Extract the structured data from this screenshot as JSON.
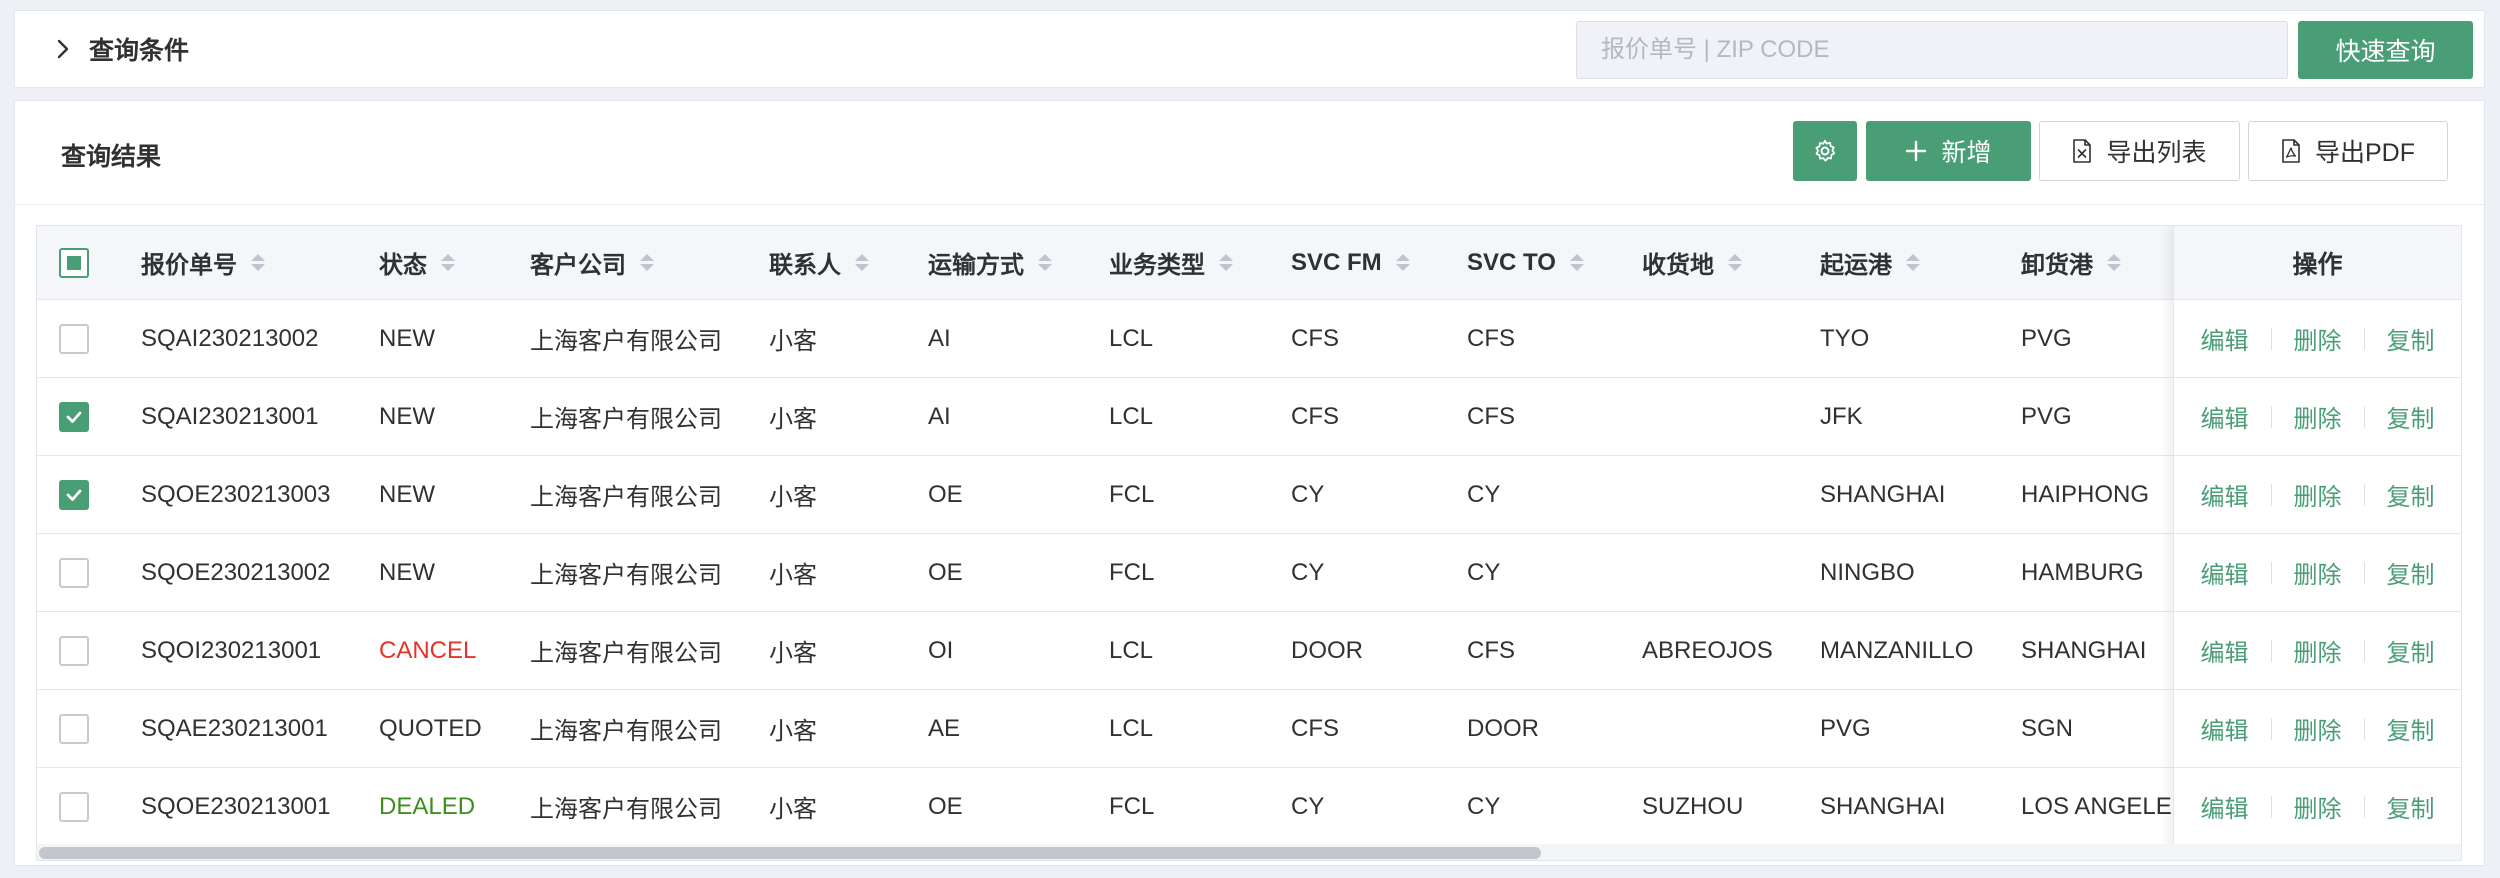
{
  "query": {
    "title": "查询条件",
    "search_placeholder": "报价单号 | ZIP CODE",
    "search_value": "",
    "quick_search_label": "快速查询"
  },
  "result": {
    "title": "查询结果",
    "add_label": "新增",
    "export_list_label": "导出列表",
    "export_pdf_label": "导出PDF"
  },
  "table": {
    "columns": {
      "quote_no": "报价单号",
      "status": "状态",
      "customer": "客户公司",
      "contact": "联系人",
      "transport": "运输方式",
      "biz_type": "业务类型",
      "svc_fm": "SVC FM",
      "svc_to": "SVC TO",
      "receipt": "收货地",
      "pol": "起运港",
      "pod": "卸货港",
      "ops": "操作"
    },
    "ops": {
      "edit": "编辑",
      "delete": "删除",
      "copy": "复制"
    },
    "colors": {
      "cancel": "#e6332a",
      "dealed": "#3d8f1c",
      "default": "#303133",
      "accent": "#4a9e76"
    },
    "rows": [
      {
        "checked": false,
        "quote_no": "SQAI230213002",
        "status": "NEW",
        "status_type": "default",
        "customer": "上海客户有限公司",
        "contact": "小客",
        "transport": "AI",
        "biz_type": "LCL",
        "svc_fm": "CFS",
        "svc_to": "CFS",
        "receipt": "",
        "pol": "TYO",
        "pod": "PVG"
      },
      {
        "checked": true,
        "quote_no": "SQAI230213001",
        "status": "NEW",
        "status_type": "default",
        "customer": "上海客户有限公司",
        "contact": "小客",
        "transport": "AI",
        "biz_type": "LCL",
        "svc_fm": "CFS",
        "svc_to": "CFS",
        "receipt": "",
        "pol": "JFK",
        "pod": "PVG"
      },
      {
        "checked": true,
        "quote_no": "SQOE230213003",
        "status": "NEW",
        "status_type": "default",
        "customer": "上海客户有限公司",
        "contact": "小客",
        "transport": "OE",
        "biz_type": "FCL",
        "svc_fm": "CY",
        "svc_to": "CY",
        "receipt": "",
        "pol": "SHANGHAI",
        "pod": "HAIPHONG"
      },
      {
        "checked": false,
        "quote_no": "SQOE230213002",
        "status": "NEW",
        "status_type": "default",
        "customer": "上海客户有限公司",
        "contact": "小客",
        "transport": "OE",
        "biz_type": "FCL",
        "svc_fm": "CY",
        "svc_to": "CY",
        "receipt": "",
        "pol": "NINGBO",
        "pod": "HAMBURG"
      },
      {
        "checked": false,
        "quote_no": "SQOI230213001",
        "status": "CANCEL",
        "status_type": "cancel",
        "customer": "上海客户有限公司",
        "contact": "小客",
        "transport": "OI",
        "biz_type": "LCL",
        "svc_fm": "DOOR",
        "svc_to": "CFS",
        "receipt": "ABREOJOS",
        "pol": "MANZANILLO",
        "pod": "SHANGHAI"
      },
      {
        "checked": false,
        "quote_no": "SQAE230213001",
        "status": "QUOTED",
        "status_type": "default",
        "customer": "上海客户有限公司",
        "contact": "小客",
        "transport": "AE",
        "biz_type": "LCL",
        "svc_fm": "CFS",
        "svc_to": "DOOR",
        "receipt": "",
        "pol": "PVG",
        "pod": "SGN"
      },
      {
        "checked": false,
        "quote_no": "SQOE230213001",
        "status": "DEALED",
        "status_type": "dealed",
        "customer": "上海客户有限公司",
        "contact": "小客",
        "transport": "OE",
        "biz_type": "FCL",
        "svc_fm": "CY",
        "svc_to": "CY",
        "receipt": "SUZHOU",
        "pol": "SHANGHAI",
        "pod": "LOS ANGELES"
      }
    ]
  }
}
